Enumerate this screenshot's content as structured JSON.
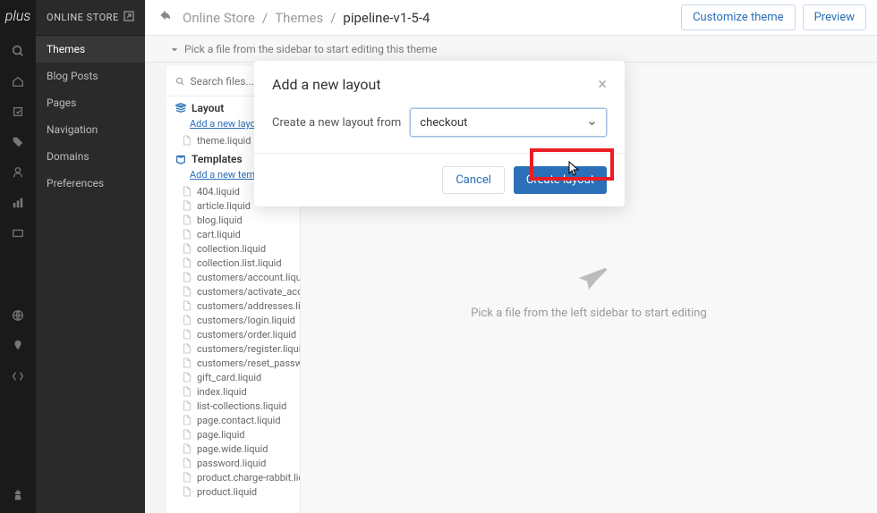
{
  "logo": "plus",
  "nav": {
    "header": "ONLINE STORE",
    "items": [
      "Themes",
      "Blog Posts",
      "Pages",
      "Navigation",
      "Domains",
      "Preferences"
    ],
    "active_index": 0
  },
  "breadcrumb": {
    "parts": [
      "Online Store",
      "Themes"
    ],
    "current": "pipeline-v1-5-4"
  },
  "topbar": {
    "customize": "Customize theme",
    "preview": "Preview"
  },
  "subheader": "Pick a file from the sidebar to start editing this theme",
  "search": {
    "placeholder": "Search files..."
  },
  "sections": {
    "layout": {
      "title": "Layout",
      "add_link": "Add a new layout",
      "files": [
        "theme.liquid"
      ]
    },
    "templates": {
      "title": "Templates",
      "add_link": "Add a new template",
      "files": [
        "404.liquid",
        "article.liquid",
        "blog.liquid",
        "cart.liquid",
        "collection.liquid",
        "collection.list.liquid",
        "customers/account.liquid",
        "customers/activate_account.liquid",
        "customers/addresses.liquid",
        "customers/login.liquid",
        "customers/order.liquid",
        "customers/register.liquid",
        "customers/reset_password.liquid",
        "gift_card.liquid",
        "index.liquid",
        "list-collections.liquid",
        "page.contact.liquid",
        "page.liquid",
        "page.wide.liquid",
        "password.liquid",
        "product.charge-rabbit.liquid",
        "product.liquid"
      ]
    }
  },
  "editor_hint": "Pick a file from the left sidebar to start editing",
  "modal": {
    "title": "Add a new layout",
    "label": "Create a new layout from",
    "selected": "checkout",
    "cancel": "Cancel",
    "create": "Create layout"
  }
}
